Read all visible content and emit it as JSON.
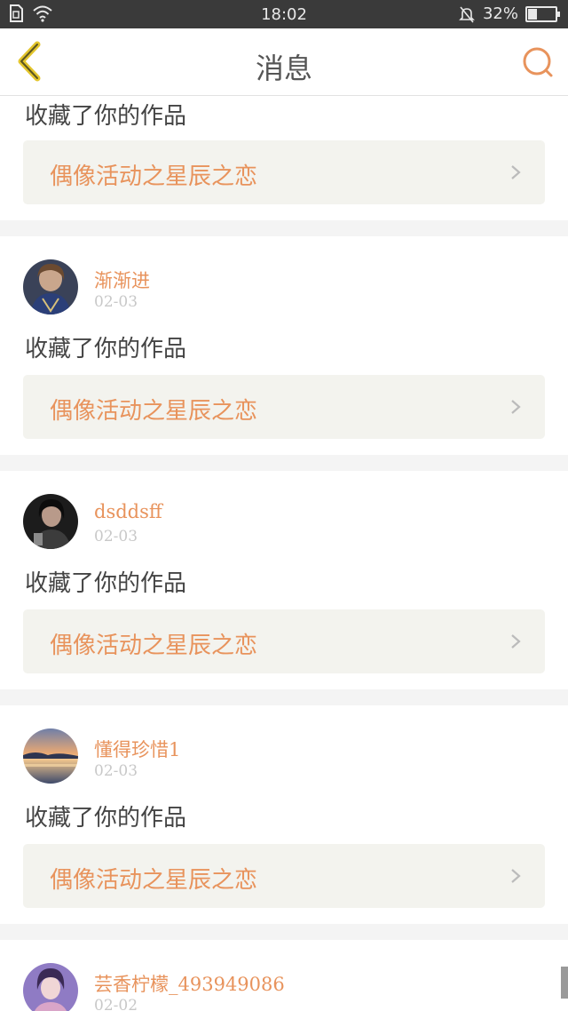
{
  "status_bar": {
    "time": "18:02",
    "battery": "32%",
    "battery_level": 0.32
  },
  "header": {
    "title": "消息"
  },
  "colors": {
    "accent": "#e8935c",
    "back_icon": "#e3c52c",
    "status_bar_bg": "#3a3a3a",
    "work_bg": "#f3f3ee"
  },
  "messages": [
    {
      "action": "收藏了你的作品",
      "work_title": "偶像活动之星辰之恋"
    },
    {
      "user": "渐渐进",
      "date": "02-03",
      "action": "收藏了你的作品",
      "work_title": "偶像活动之星辰之恋"
    },
    {
      "user": "dsddsff",
      "date": "02-03",
      "action": "收藏了你的作品",
      "work_title": "偶像活动之星辰之恋"
    },
    {
      "user": "懂得珍惜1",
      "date": "02-03",
      "action": "收藏了你的作品",
      "work_title": "偶像活动之星辰之恋"
    },
    {
      "user": "芸香柠檬_493949086",
      "date": "02-02"
    }
  ]
}
